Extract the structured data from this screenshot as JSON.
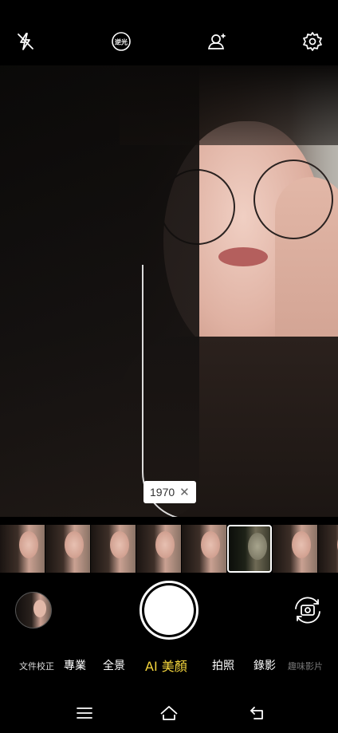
{
  "top_bar": {
    "icons": [
      "flash-off-icon",
      "backlight-icon",
      "add-person-icon",
      "settings-icon"
    ],
    "backlight_label": "逆光"
  },
  "viewfinder": {
    "filter_tag": {
      "name": "1970",
      "close_symbol": "✕"
    },
    "beauty_label": "美顏"
  },
  "filter_strip": {
    "count": 8,
    "selected_index": 5
  },
  "controls": {
    "gallery_icon": "gallery-thumbnail-icon",
    "shutter_icon": "shutter-icon",
    "switch_camera_icon": "switch-camera-icon"
  },
  "modes": [
    {
      "label": "文件校正"
    },
    {
      "label": "專業"
    },
    {
      "label": "全景"
    },
    {
      "label": "AI 美顏",
      "active": true
    },
    {
      "label": "拍照"
    },
    {
      "label": "錄影"
    },
    {
      "label": "趣味影片"
    }
  ],
  "nav_bar": {
    "icons": [
      "menu-icon",
      "home-icon",
      "back-icon"
    ]
  },
  "colors": {
    "accent": "#f4d53c",
    "background": "#000000"
  }
}
